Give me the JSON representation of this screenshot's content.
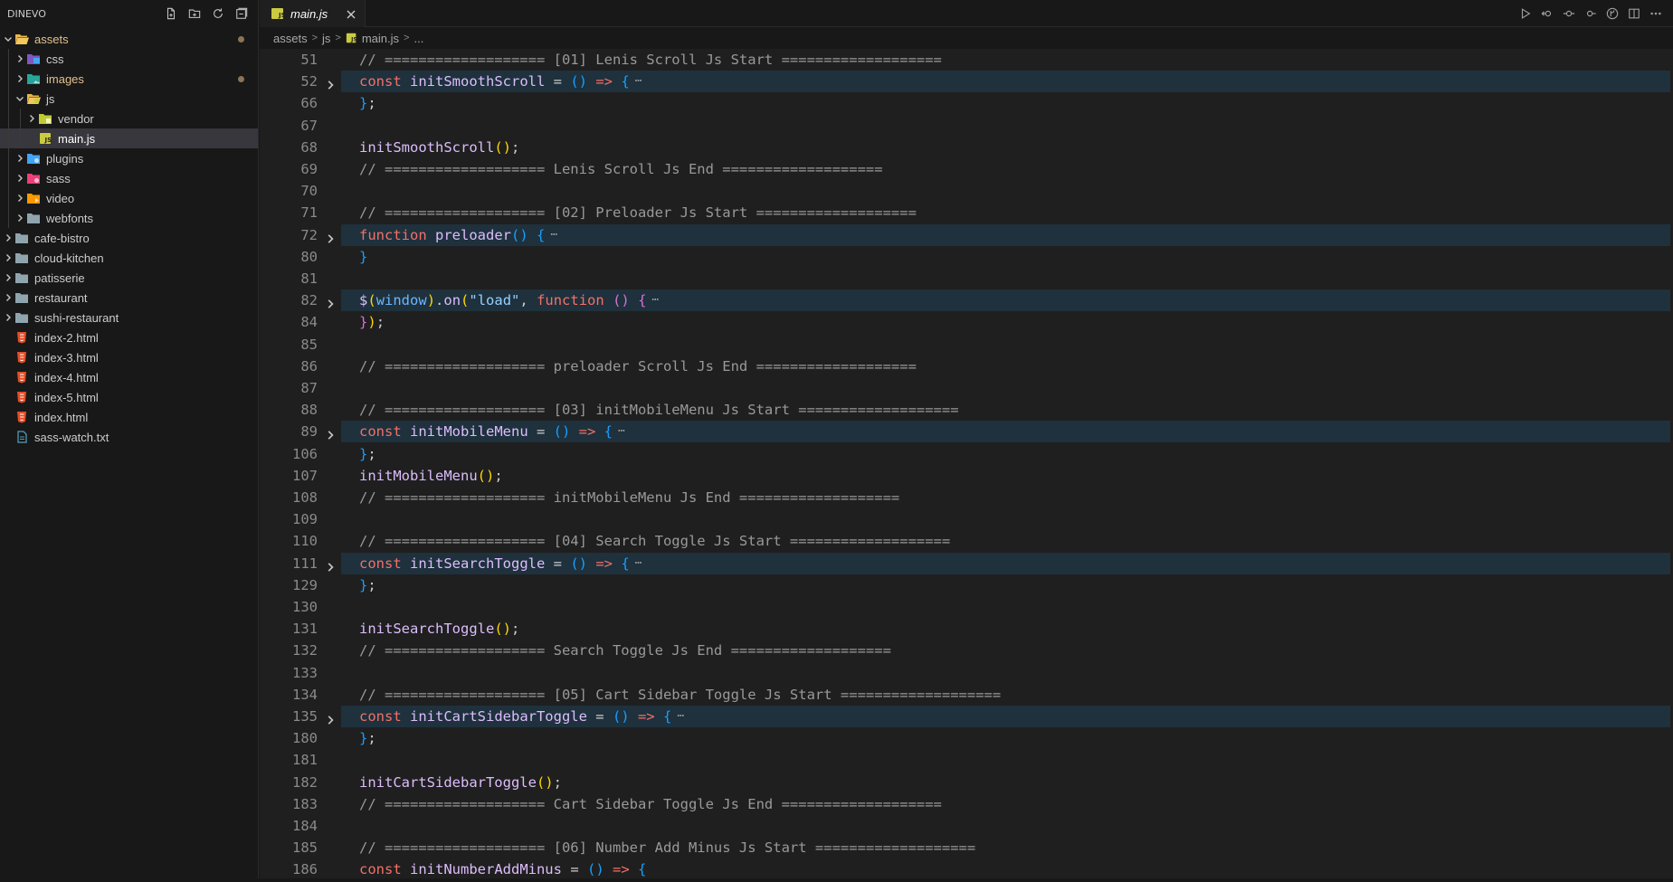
{
  "explorer": {
    "title": "DINEVO",
    "tree": [
      {
        "label": "assets",
        "depth": 0,
        "type": "folder",
        "open": true,
        "modified": true,
        "icon": "folder-open-icon"
      },
      {
        "label": "css",
        "depth": 1,
        "type": "folder",
        "open": false,
        "modified": false,
        "icon": "folder-css-icon"
      },
      {
        "label": "images",
        "depth": 1,
        "type": "folder",
        "open": false,
        "modified": true,
        "icon": "folder-images-icon"
      },
      {
        "label": "js",
        "depth": 1,
        "type": "folder",
        "open": true,
        "modified": false,
        "icon": "folder-js-icon"
      },
      {
        "label": "vendor",
        "depth": 2,
        "type": "folder",
        "open": false,
        "modified": false,
        "icon": "folder-vendor-icon"
      },
      {
        "label": "main.js",
        "depth": 2,
        "type": "file",
        "selected": true,
        "modified": false,
        "icon": "js-file-icon"
      },
      {
        "label": "plugins",
        "depth": 1,
        "type": "folder",
        "open": false,
        "modified": false,
        "icon": "folder-plugins-icon"
      },
      {
        "label": "sass",
        "depth": 1,
        "type": "folder",
        "open": false,
        "modified": false,
        "icon": "folder-sass-icon"
      },
      {
        "label": "video",
        "depth": 1,
        "type": "folder",
        "open": false,
        "modified": false,
        "icon": "folder-video-icon"
      },
      {
        "label": "webfonts",
        "depth": 1,
        "type": "folder",
        "open": false,
        "modified": false,
        "icon": "folder-icon"
      },
      {
        "label": "cafe-bistro",
        "depth": 0,
        "type": "folder",
        "open": false,
        "modified": false,
        "icon": "folder-icon"
      },
      {
        "label": "cloud-kitchen",
        "depth": 0,
        "type": "folder",
        "open": false,
        "modified": false,
        "icon": "folder-icon"
      },
      {
        "label": "patisserie",
        "depth": 0,
        "type": "folder",
        "open": false,
        "modified": false,
        "icon": "folder-icon"
      },
      {
        "label": "restaurant",
        "depth": 0,
        "type": "folder",
        "open": false,
        "modified": false,
        "icon": "folder-icon"
      },
      {
        "label": "sushi-restaurant",
        "depth": 0,
        "type": "folder",
        "open": false,
        "modified": false,
        "icon": "folder-icon"
      },
      {
        "label": "index-2.html",
        "depth": 0,
        "type": "file",
        "modified": false,
        "icon": "html-file-icon"
      },
      {
        "label": "index-3.html",
        "depth": 0,
        "type": "file",
        "modified": false,
        "icon": "html-file-icon"
      },
      {
        "label": "index-4.html",
        "depth": 0,
        "type": "file",
        "modified": false,
        "icon": "html-file-icon"
      },
      {
        "label": "index-5.html",
        "depth": 0,
        "type": "file",
        "modified": false,
        "icon": "html-file-icon"
      },
      {
        "label": "index.html",
        "depth": 0,
        "type": "file",
        "modified": false,
        "icon": "html-file-icon"
      },
      {
        "label": "sass-watch.txt",
        "depth": 0,
        "type": "file",
        "modified": false,
        "icon": "text-file-icon"
      }
    ]
  },
  "tab": {
    "label": "main.js"
  },
  "breadcrumb": {
    "parts": [
      "assets",
      "js",
      "main.js",
      "..."
    ]
  },
  "colors": {
    "accent_folder": "#e2c08d",
    "selection": "#37373d",
    "fold_highlight": "#1e313d"
  },
  "code": [
    {
      "n": "51",
      "fold": false,
      "tokens": [
        [
          "c",
          "// =================== [01] Lenis Scroll Js Start ==================="
        ]
      ]
    },
    {
      "n": "52",
      "fold": true,
      "tokens": [
        [
          "k",
          "const "
        ],
        [
          "f",
          "initSmoothScroll"
        ],
        [
          "p",
          " = "
        ],
        [
          "b",
          "()"
        ],
        [
          "o",
          " => "
        ],
        [
          "b",
          "{"
        ]
      ]
    },
    {
      "n": "66",
      "fold": false,
      "tokens": [
        [
          "b",
          "}"
        ],
        [
          "p",
          ";"
        ]
      ]
    },
    {
      "n": "67",
      "fold": false,
      "tokens": []
    },
    {
      "n": "68",
      "fold": false,
      "tokens": [
        [
          "f",
          "initSmoothScroll"
        ],
        [
          "y",
          "()"
        ],
        [
          "p",
          ";"
        ]
      ]
    },
    {
      "n": "69",
      "fold": false,
      "tokens": [
        [
          "c",
          "// =================== Lenis Scroll Js End ==================="
        ]
      ]
    },
    {
      "n": "70",
      "fold": false,
      "tokens": []
    },
    {
      "n": "71",
      "fold": false,
      "tokens": [
        [
          "c",
          "// =================== [02] Preloader Js Start ==================="
        ]
      ]
    },
    {
      "n": "72",
      "fold": true,
      "tokens": [
        [
          "k",
          "function "
        ],
        [
          "f",
          "preloader"
        ],
        [
          "b",
          "()"
        ],
        [
          "p",
          " "
        ],
        [
          "b",
          "{"
        ]
      ]
    },
    {
      "n": "80",
      "fold": false,
      "tokens": [
        [
          "b",
          "}"
        ]
      ]
    },
    {
      "n": "81",
      "fold": false,
      "tokens": []
    },
    {
      "n": "82",
      "fold": true,
      "tokens": [
        [
          "f",
          "$"
        ],
        [
          "y",
          "("
        ],
        [
          "v",
          "window"
        ],
        [
          "y",
          ")"
        ],
        [
          "p",
          "."
        ],
        [
          "f",
          "on"
        ],
        [
          "y",
          "("
        ],
        [
          "s",
          "\"load\""
        ],
        [
          "p",
          ", "
        ],
        [
          "k",
          "function "
        ],
        [
          "m",
          "()"
        ],
        [
          "p",
          " "
        ],
        [
          "m",
          "{"
        ]
      ]
    },
    {
      "n": "84",
      "fold": false,
      "tokens": [
        [
          "m",
          "}"
        ],
        [
          "y",
          ")"
        ],
        [
          "p",
          ";"
        ]
      ]
    },
    {
      "n": "85",
      "fold": false,
      "tokens": []
    },
    {
      "n": "86",
      "fold": false,
      "tokens": [
        [
          "c",
          "// =================== preloader Scroll Js End ==================="
        ]
      ]
    },
    {
      "n": "87",
      "fold": false,
      "tokens": []
    },
    {
      "n": "88",
      "fold": false,
      "tokens": [
        [
          "c",
          "// =================== [03] initMobileMenu Js Start ==================="
        ]
      ]
    },
    {
      "n": "89",
      "fold": true,
      "tokens": [
        [
          "k",
          "const "
        ],
        [
          "f",
          "initMobileMenu"
        ],
        [
          "p",
          " = "
        ],
        [
          "b",
          "()"
        ],
        [
          "o",
          " => "
        ],
        [
          "b",
          "{"
        ]
      ]
    },
    {
      "n": "106",
      "fold": false,
      "tokens": [
        [
          "b",
          "}"
        ],
        [
          "p",
          ";"
        ]
      ]
    },
    {
      "n": "107",
      "fold": false,
      "tokens": [
        [
          "f",
          "initMobileMenu"
        ],
        [
          "y",
          "()"
        ],
        [
          "p",
          ";"
        ]
      ]
    },
    {
      "n": "108",
      "fold": false,
      "tokens": [
        [
          "c",
          "// =================== initMobileMenu Js End ==================="
        ]
      ]
    },
    {
      "n": "109",
      "fold": false,
      "tokens": []
    },
    {
      "n": "110",
      "fold": false,
      "tokens": [
        [
          "c",
          "// =================== [04] Search Toggle Js Start ==================="
        ]
      ]
    },
    {
      "n": "111",
      "fold": true,
      "tokens": [
        [
          "k",
          "const "
        ],
        [
          "f",
          "initSearchToggle"
        ],
        [
          "p",
          " = "
        ],
        [
          "b",
          "()"
        ],
        [
          "o",
          " => "
        ],
        [
          "b",
          "{"
        ]
      ]
    },
    {
      "n": "129",
      "fold": false,
      "tokens": [
        [
          "b",
          "}"
        ],
        [
          "p",
          ";"
        ]
      ]
    },
    {
      "n": "130",
      "fold": false,
      "tokens": []
    },
    {
      "n": "131",
      "fold": false,
      "tokens": [
        [
          "f",
          "initSearchToggle"
        ],
        [
          "y",
          "()"
        ],
        [
          "p",
          ";"
        ]
      ]
    },
    {
      "n": "132",
      "fold": false,
      "tokens": [
        [
          "c",
          "// =================== Search Toggle Js End ==================="
        ]
      ]
    },
    {
      "n": "133",
      "fold": false,
      "tokens": []
    },
    {
      "n": "134",
      "fold": false,
      "tokens": [
        [
          "c",
          "// =================== [05] Cart Sidebar Toggle Js Start ==================="
        ]
      ]
    },
    {
      "n": "135",
      "fold": true,
      "tokens": [
        [
          "k",
          "const "
        ],
        [
          "f",
          "initCartSidebarToggle"
        ],
        [
          "p",
          " = "
        ],
        [
          "b",
          "()"
        ],
        [
          "o",
          " => "
        ],
        [
          "b",
          "{"
        ]
      ]
    },
    {
      "n": "180",
      "fold": false,
      "tokens": [
        [
          "b",
          "}"
        ],
        [
          "p",
          ";"
        ]
      ]
    },
    {
      "n": "181",
      "fold": false,
      "tokens": []
    },
    {
      "n": "182",
      "fold": false,
      "tokens": [
        [
          "f",
          "initCartSidebarToggle"
        ],
        [
          "y",
          "()"
        ],
        [
          "p",
          ";"
        ]
      ]
    },
    {
      "n": "183",
      "fold": false,
      "tokens": [
        [
          "c",
          "// =================== Cart Sidebar Toggle Js End ==================="
        ]
      ]
    },
    {
      "n": "184",
      "fold": false,
      "tokens": []
    },
    {
      "n": "185",
      "fold": false,
      "tokens": [
        [
          "c",
          "// =================== [06] Number Add Minus Js Start ==================="
        ]
      ]
    },
    {
      "n": "186",
      "fold": false,
      "tokens": [
        [
          "k",
          "const "
        ],
        [
          "f",
          "initNumberAddMinus"
        ],
        [
          "p",
          " = "
        ],
        [
          "b",
          "()"
        ],
        [
          "o",
          " => "
        ],
        [
          "b",
          "{"
        ]
      ]
    }
  ]
}
